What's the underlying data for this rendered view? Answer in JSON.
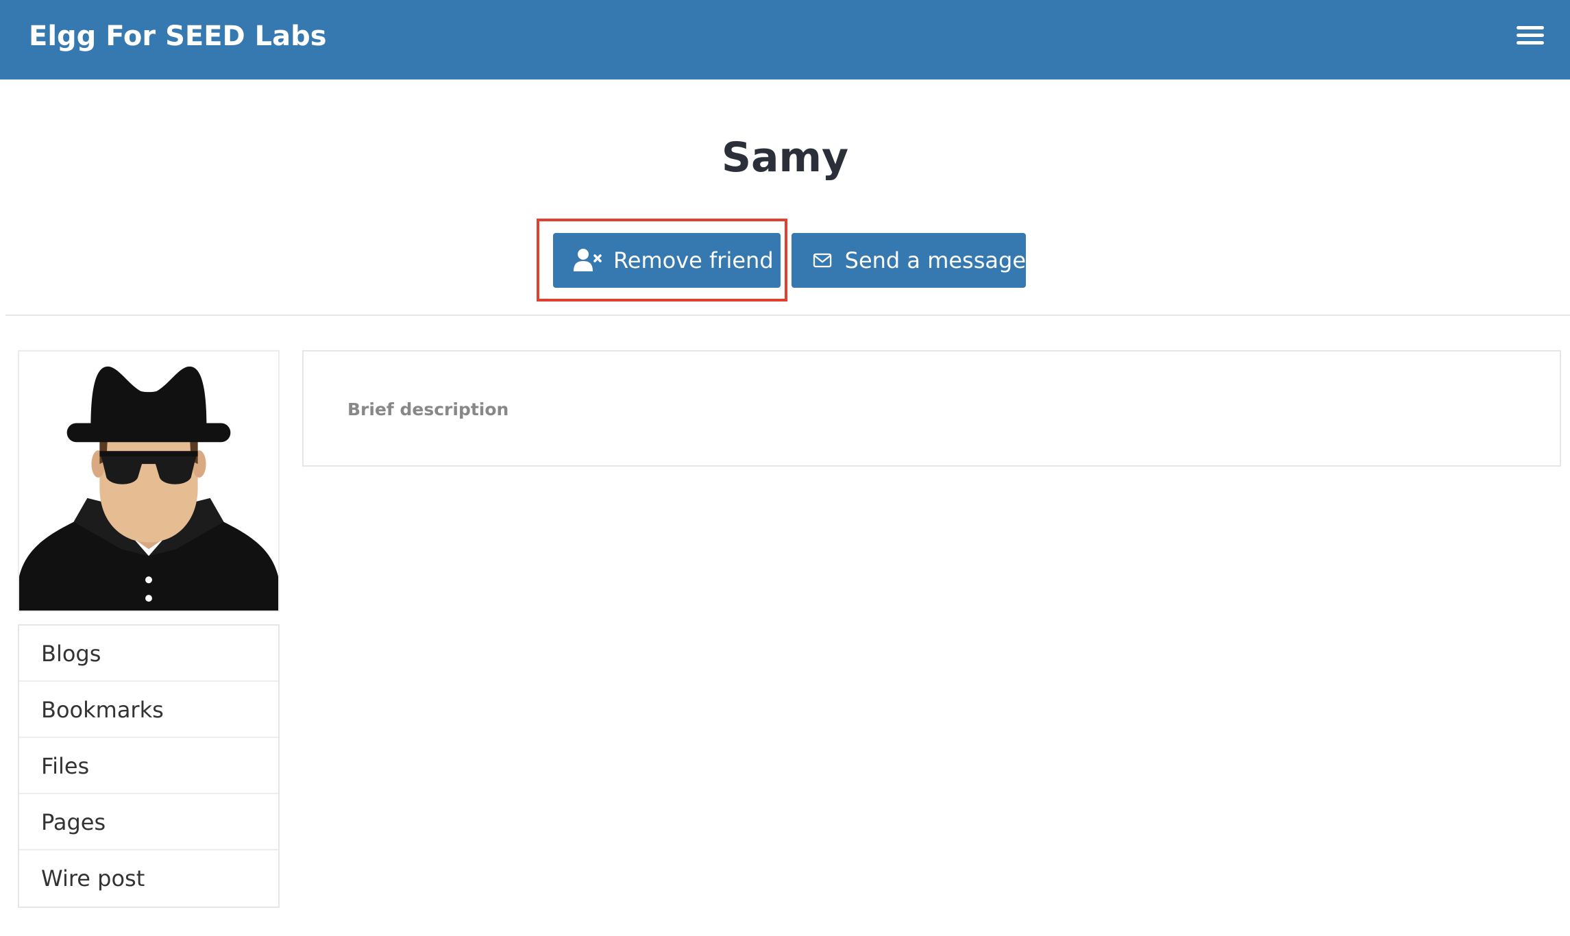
{
  "header": {
    "site_title": "Elgg For SEED Labs",
    "menu_icon": "hamburger-menu-icon",
    "background_color": "#3679b1"
  },
  "profile": {
    "name": "Samy",
    "avatar_icon": "spy-avatar-icon"
  },
  "actions": {
    "remove_friend_label": "Remove friend",
    "remove_friend_icon": "user-remove-icon",
    "send_message_label": "Send a message",
    "send_message_icon": "envelope-icon",
    "highlight_color": "#e0412f"
  },
  "sidebar": {
    "items": [
      {
        "label": "Blogs"
      },
      {
        "label": "Bookmarks"
      },
      {
        "label": "Files"
      },
      {
        "label": "Pages"
      },
      {
        "label": "Wire post"
      }
    ]
  },
  "details": {
    "brief_description_label": "Brief description"
  }
}
